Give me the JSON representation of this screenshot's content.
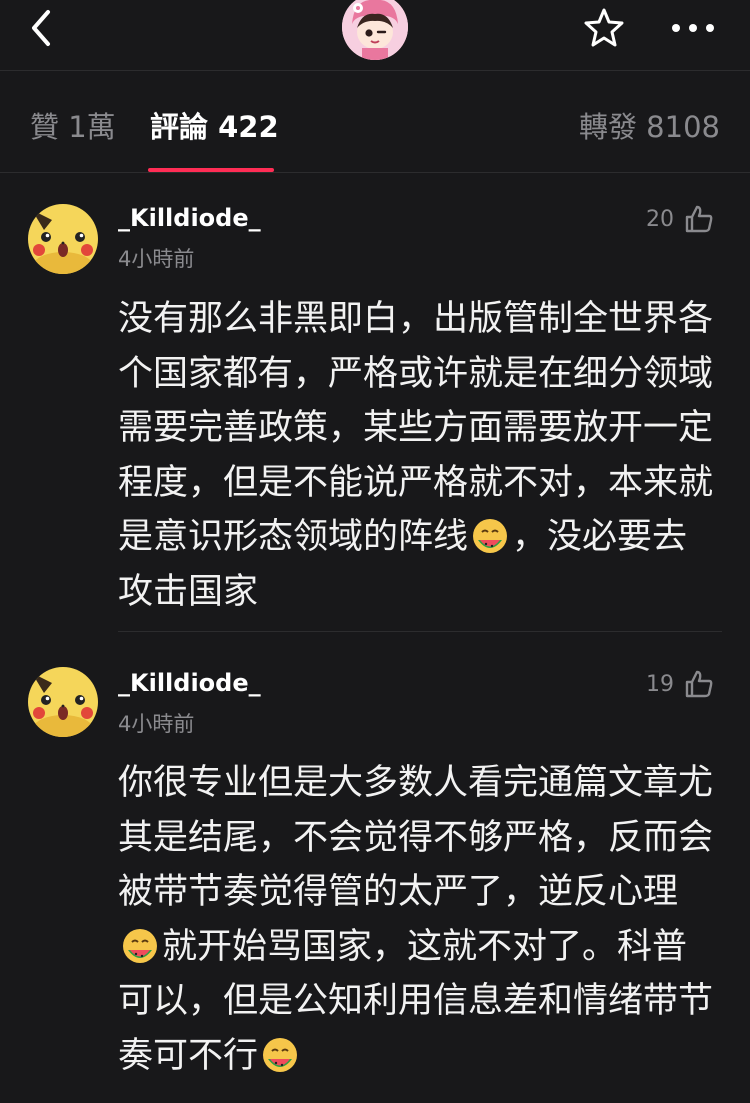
{
  "header": {
    "back_icon": "chevron-left-icon",
    "star_icon": "star-icon",
    "more_icon": "more-dots-icon"
  },
  "tabs": {
    "likes": "贊 1萬",
    "comments": "評論 422",
    "reposts": "轉發 8108"
  },
  "colors": {
    "accent": "#ff2d55",
    "background": "#18181a",
    "muted": "#8a8a8e"
  },
  "comments": [
    {
      "username": "_Killdiode_",
      "time": "4小時前",
      "likes": "20",
      "text_before_emoji": "没有那么非黑即白，出版管制全世界各个国家都有，严格或许就是在细分领域需要完善政策，某些方面需要放开一定程度，但是不能说严格就不对，本来就是意识形态领域的阵线",
      "text_after_emoji": "，没必要去攻击国家"
    },
    {
      "username": "_Killdiode_",
      "time": "4小時前",
      "likes": "19",
      "text_before_emoji": "你很专业但是大多数人看完通篇文章尤其是结尾，不会觉得不够严格，反而会被带节奏觉得管的太严了，逆反心理",
      "text_middle": "就开始骂国家，这就不对了。科普可以，但是公知利用信息差和情绪带节奏可不行",
      "text_after_emoji": ""
    }
  ]
}
